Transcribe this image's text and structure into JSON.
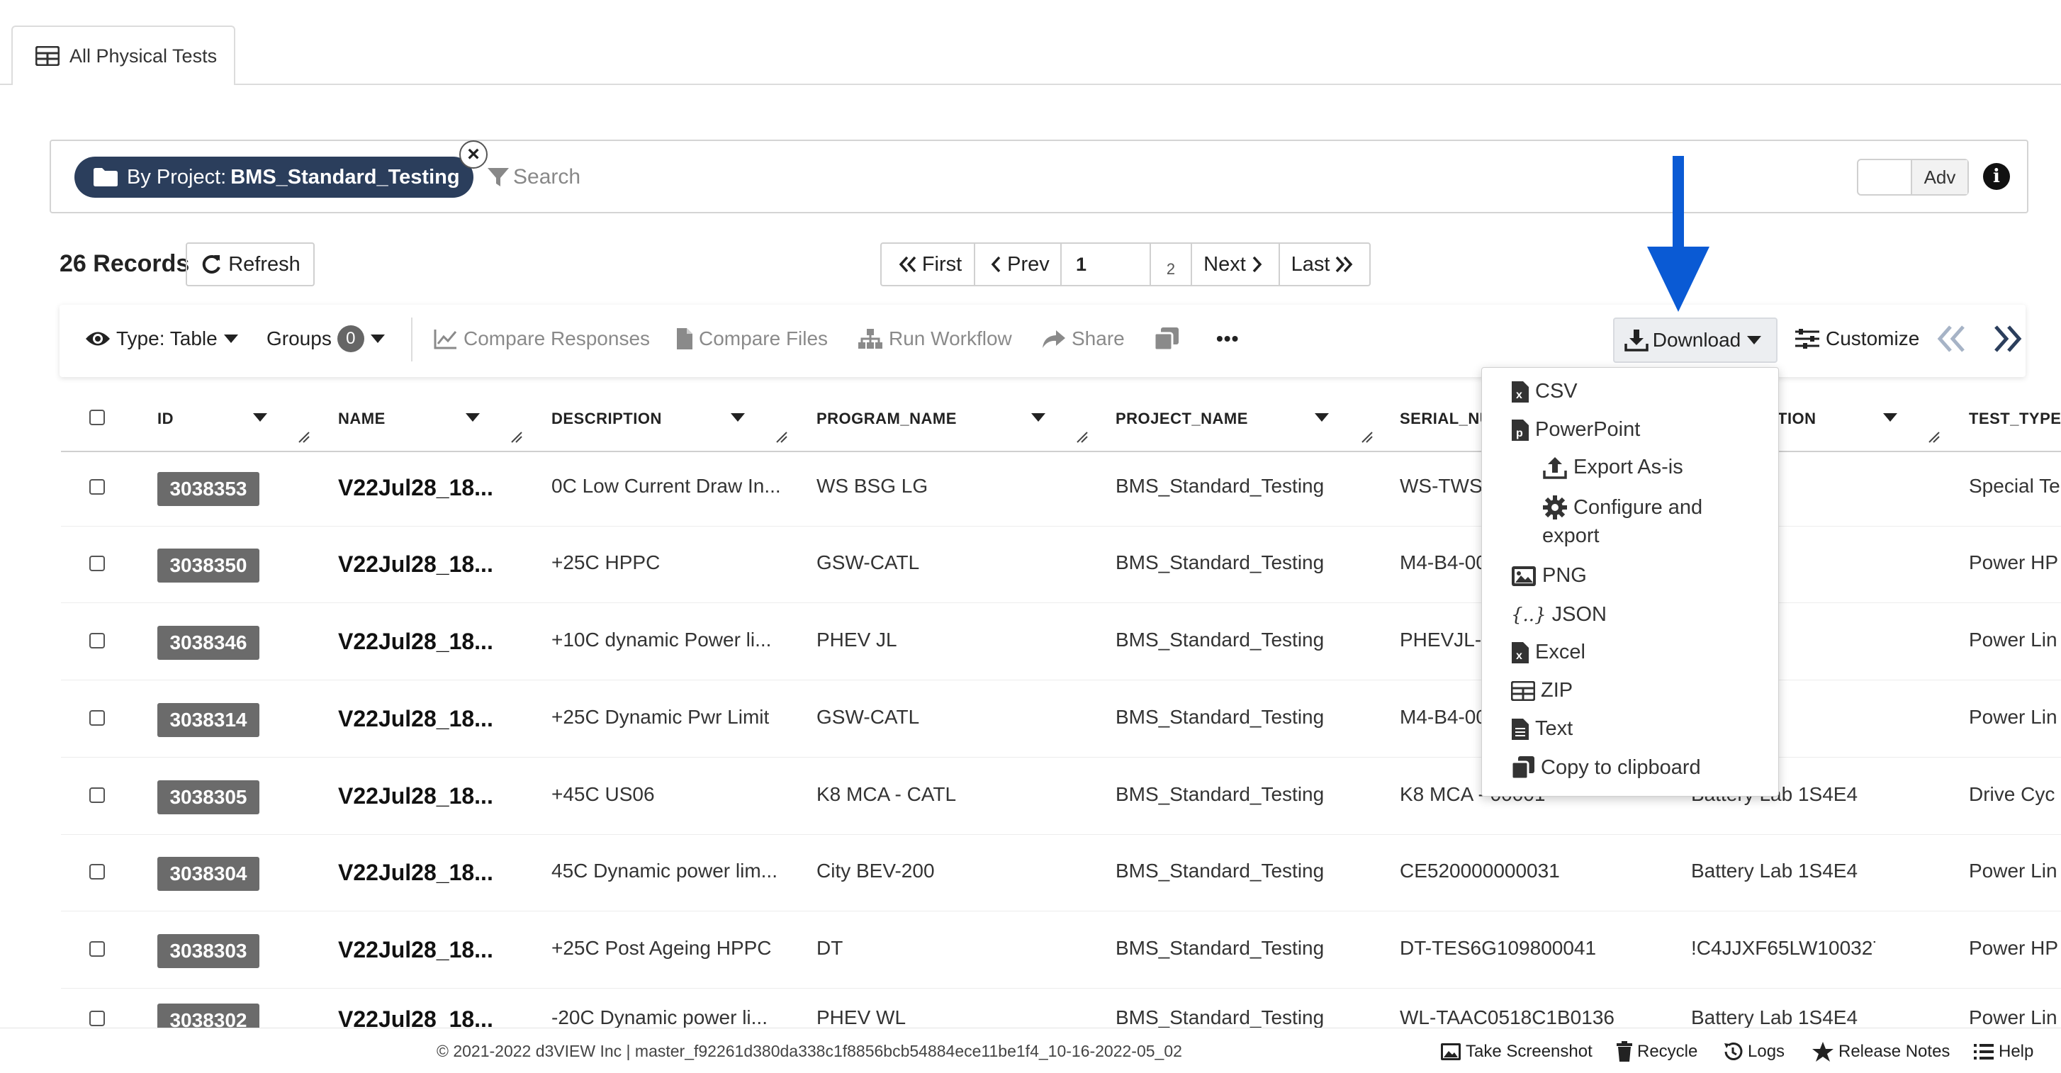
{
  "tab": {
    "label": "All Physical Tests"
  },
  "filter": {
    "chip_prefix": "By Project:",
    "chip_value": "BMS_Standard_Testing",
    "search_placeholder": "Search",
    "adv_label": "Adv",
    "info_label": "i"
  },
  "records": {
    "count_label": "26 Records",
    "refresh_label": "Refresh"
  },
  "pager": {
    "first": "First",
    "prev": "Prev",
    "current_page": "1",
    "total_pages": "2",
    "next": "Next",
    "last": "Last"
  },
  "toolbar": {
    "type_label": "Type: Table",
    "groups_label": "Groups",
    "groups_count": "0",
    "compare_responses": "Compare Responses",
    "compare_files": "Compare Files",
    "run_workflow": "Run Workflow",
    "share": "Share",
    "more": "•••",
    "download": "Download",
    "customize": "Customize"
  },
  "columns": [
    "ID",
    "NAME",
    "DESCRIPTION",
    "PROGRAM_NAME",
    "PROJECT_NAME",
    "SERIAL_NU",
    "TION",
    "TEST_TYPE"
  ],
  "rows": [
    {
      "id": "3038353",
      "name": "V22Jul28_18...",
      "description": "0C Low Current Draw In...",
      "program": "WS BSG LG",
      "project": "BMS_Standard_Testing",
      "serial": "WS-TWS6",
      "location": "",
      "test_type": "Special Te"
    },
    {
      "id": "3038350",
      "name": "V22Jul28_18...",
      "description": "+25C HPPC",
      "program": "GSW-CATL",
      "project": "BMS_Standard_Testing",
      "serial": "M4-B4-00",
      "location": "b 1S4E4",
      "test_type": "Power HP"
    },
    {
      "id": "3038346",
      "name": "V22Jul28_18...",
      "description": "+10C dynamic Power li...",
      "program": "PHEV JL",
      "project": "BMS_Standard_Testing",
      "serial": "PHEVJL-C",
      "location": "b 1S4E4",
      "test_type": "Power Lin"
    },
    {
      "id": "3038314",
      "name": "V22Jul28_18...",
      "description": "+25C Dynamic Pwr Limit",
      "program": "GSW-CATL",
      "project": "BMS_Standard_Testing",
      "serial": "M4-B4-00",
      "location": "b 1S4E4",
      "test_type": "Power Lin"
    },
    {
      "id": "3038305",
      "name": "V22Jul28_18...",
      "description": "+45C US06",
      "program": "K8 MCA - CATL",
      "project": "BMS_Standard_Testing",
      "serial": "K8 MCA - 00001",
      "location": "Battery Lab 1S4E4",
      "test_type": "Drive Cyc"
    },
    {
      "id": "3038304",
      "name": "V22Jul28_18...",
      "description": "45C Dynamic power lim...",
      "program": "City BEV-200",
      "project": "BMS_Standard_Testing",
      "serial": "CE520000000031",
      "location": "Battery Lab 1S4E4",
      "test_type": "Power Lin"
    },
    {
      "id": "3038303",
      "name": "V22Jul28_18...",
      "description": "+25C Post Ageing HPPC",
      "program": "DT",
      "project": "BMS_Standard_Testing",
      "serial": "DT-TES6G109800041",
      "location": "!C4JJXF65LW100327",
      "test_type": "Power HP"
    },
    {
      "id": "3038302",
      "name": "V22Jul28_18...",
      "description": "-20C Dynamic power li...",
      "program": "PHEV WL",
      "project": "BMS_Standard_Testing",
      "serial": "WL-TAAC0518C1B0136",
      "location": "Battery Lab 1S4E4",
      "test_type": "Power Lin"
    }
  ],
  "download_menu": {
    "csv": "CSV",
    "powerpoint": "PowerPoint",
    "export_as_is": "Export As-is",
    "configure_line1": "Configure and",
    "configure_line2": "export",
    "png": "PNG",
    "json_icon": "{..}",
    "json": "JSON",
    "excel": "Excel",
    "zip": "ZIP",
    "text": "Text",
    "clipboard": "Copy to clipboard"
  },
  "footer": {
    "copyright": "© 2021-2022 d3VIEW Inc | master_f92261d380da338c1f8856bcb54884ece11be1f4_10-16-2022-05_02",
    "screenshot": "Take Screenshot",
    "recycle": "Recycle",
    "logs": "Logs",
    "release_notes": "Release Notes",
    "help": "Help"
  },
  "colors": {
    "chip_bg": "#2b3e5c",
    "id_badge": "#6b6b6b",
    "annotation_arrow": "#0a5ad4"
  },
  "icons": [
    "table-icon",
    "folder-icon",
    "filter-icon",
    "refresh-icon",
    "eye-icon",
    "chart-line-icon",
    "file-icon",
    "sitemap-icon",
    "share-icon",
    "copy-icon",
    "download-icon",
    "sliders-icon",
    "chevrons-left-icon",
    "chevrons-right-icon",
    "camera-icon",
    "trash-icon",
    "history-icon",
    "star-icon",
    "list-icon"
  ]
}
